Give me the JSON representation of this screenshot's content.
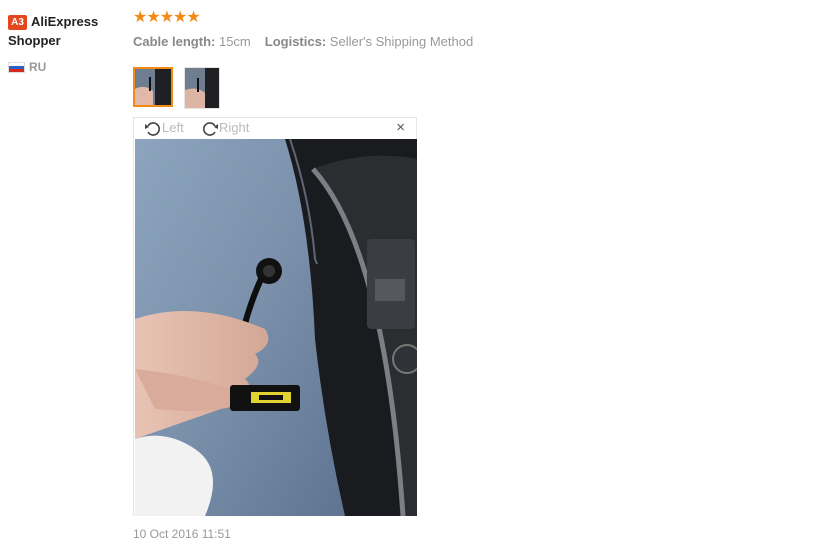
{
  "user": {
    "badge": "A3",
    "name": "AliExpress Shopper",
    "country": "RU"
  },
  "review": {
    "stars": "★★★★★",
    "rating": 5,
    "meta": [
      {
        "label": "Cable length:",
        "value": "15cm"
      },
      {
        "label": "Logistics:",
        "value": "Seller's Shipping Method"
      }
    ],
    "date": "10 Oct 2016 11:51"
  },
  "viewer": {
    "rotate_left": "Left",
    "rotate_right": "Right",
    "close": "×"
  },
  "colors": {
    "accent": "#f48a16",
    "badge": "#e4471b",
    "muted": "#999999"
  }
}
